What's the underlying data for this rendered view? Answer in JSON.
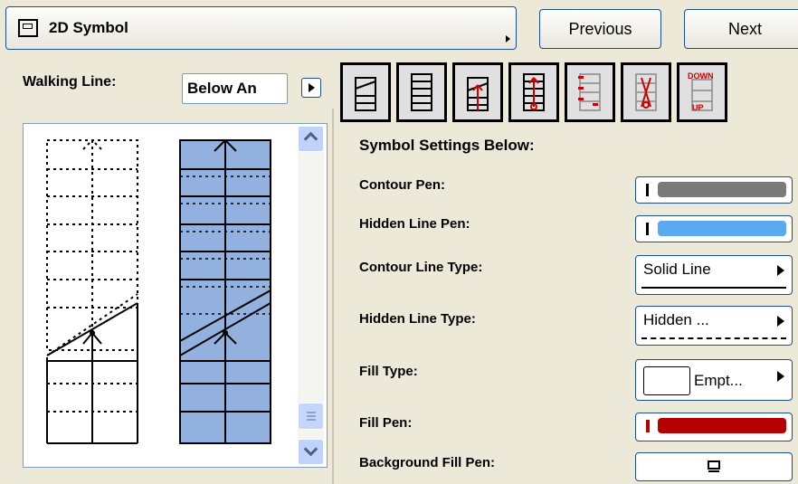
{
  "header": {
    "title": "2D Symbol",
    "prev_label": "Previous",
    "next_label": "Next"
  },
  "walking": {
    "label": "Walking Line:",
    "value": "Below An"
  },
  "settings": {
    "heading": "Symbol Settings Below:",
    "contour_pen": "Contour Pen:",
    "hidden_pen": "Hidden Line Pen:",
    "contour_type": "Contour Line Type:",
    "contour_type_value": "Solid Line",
    "hidden_type": "Hidden Line Type:",
    "hidden_type_value": "Hidden ...",
    "fill_type": "Fill Type:",
    "fill_type_value": "Empt...",
    "fill_pen": "Fill Pen:",
    "bg_fill_pen": "Background Fill Pen:"
  },
  "thumbnail_down_up": [
    "DOWN",
    "UP"
  ],
  "colors": {
    "contour_pen": "#7a7a7a",
    "hidden_pen": "#5aaaf0",
    "fill_pen": "#b40000",
    "preview_fill": "#93b1de"
  },
  "thumbnails": [
    "stair-below-icon",
    "stair-full-icon",
    "stair-arrow-icon",
    "stair-arrow-red-icon",
    "stair-labels-icon",
    "stair-text-icon",
    "stair-down-up-icon"
  ]
}
